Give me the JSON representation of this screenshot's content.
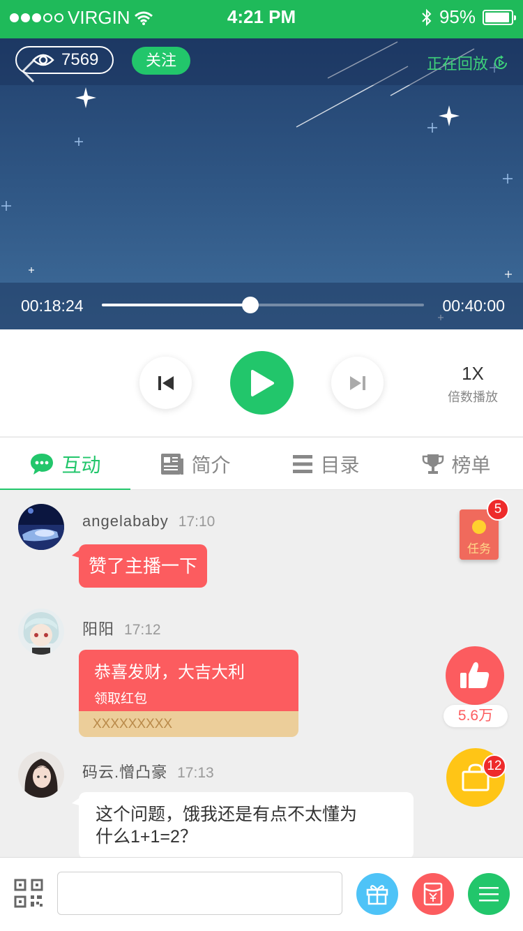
{
  "status_bar": {
    "carrier": "VIRGIN",
    "time": "4:21 PM",
    "battery": "95%",
    "battery_level": 0.95
  },
  "video": {
    "viewer_count": "7569",
    "follow_label": "关注",
    "replay_label": "正在回放",
    "current_time": "00:18:24",
    "total_time": "00:40:00",
    "progress": 0.46
  },
  "controls": {
    "speed_value": "1X",
    "speed_label": "倍数播放"
  },
  "tabs": [
    {
      "label": "互动",
      "icon": "chat-bubble-icon",
      "active": true
    },
    {
      "label": "简介",
      "icon": "newspaper-icon",
      "active": false
    },
    {
      "label": "目录",
      "icon": "list-icon",
      "active": false
    },
    {
      "label": "榜单",
      "icon": "trophy-icon",
      "active": false
    }
  ],
  "messages": [
    {
      "user": "angelababy",
      "time": "17:10",
      "text": "赞了主播一下"
    },
    {
      "user": "阳阳",
      "time": "17:12",
      "packet_title": "恭喜发财，大吉大利",
      "packet_sub": "领取红包",
      "packet_footer": "XXXXXXXXX"
    },
    {
      "user": "码云.憎凸豪",
      "time": "17:13",
      "text_line1": "这个问题，饿我还是有点不太懂为",
      "text_line2": "什么1+1=2？"
    }
  ],
  "floating": {
    "task_label": "任务",
    "task_badge": "5",
    "like_count": "5.6万",
    "shop_badge": "12"
  },
  "bottom_bar": {
    "input_placeholder": ""
  },
  "colors": {
    "brand_green": "#22c66b",
    "status_green": "#1fba5a",
    "red": "#fc5c5f",
    "gold": "#ecce9a",
    "yellow": "#ffc516",
    "blue": "#4ec3f7"
  }
}
